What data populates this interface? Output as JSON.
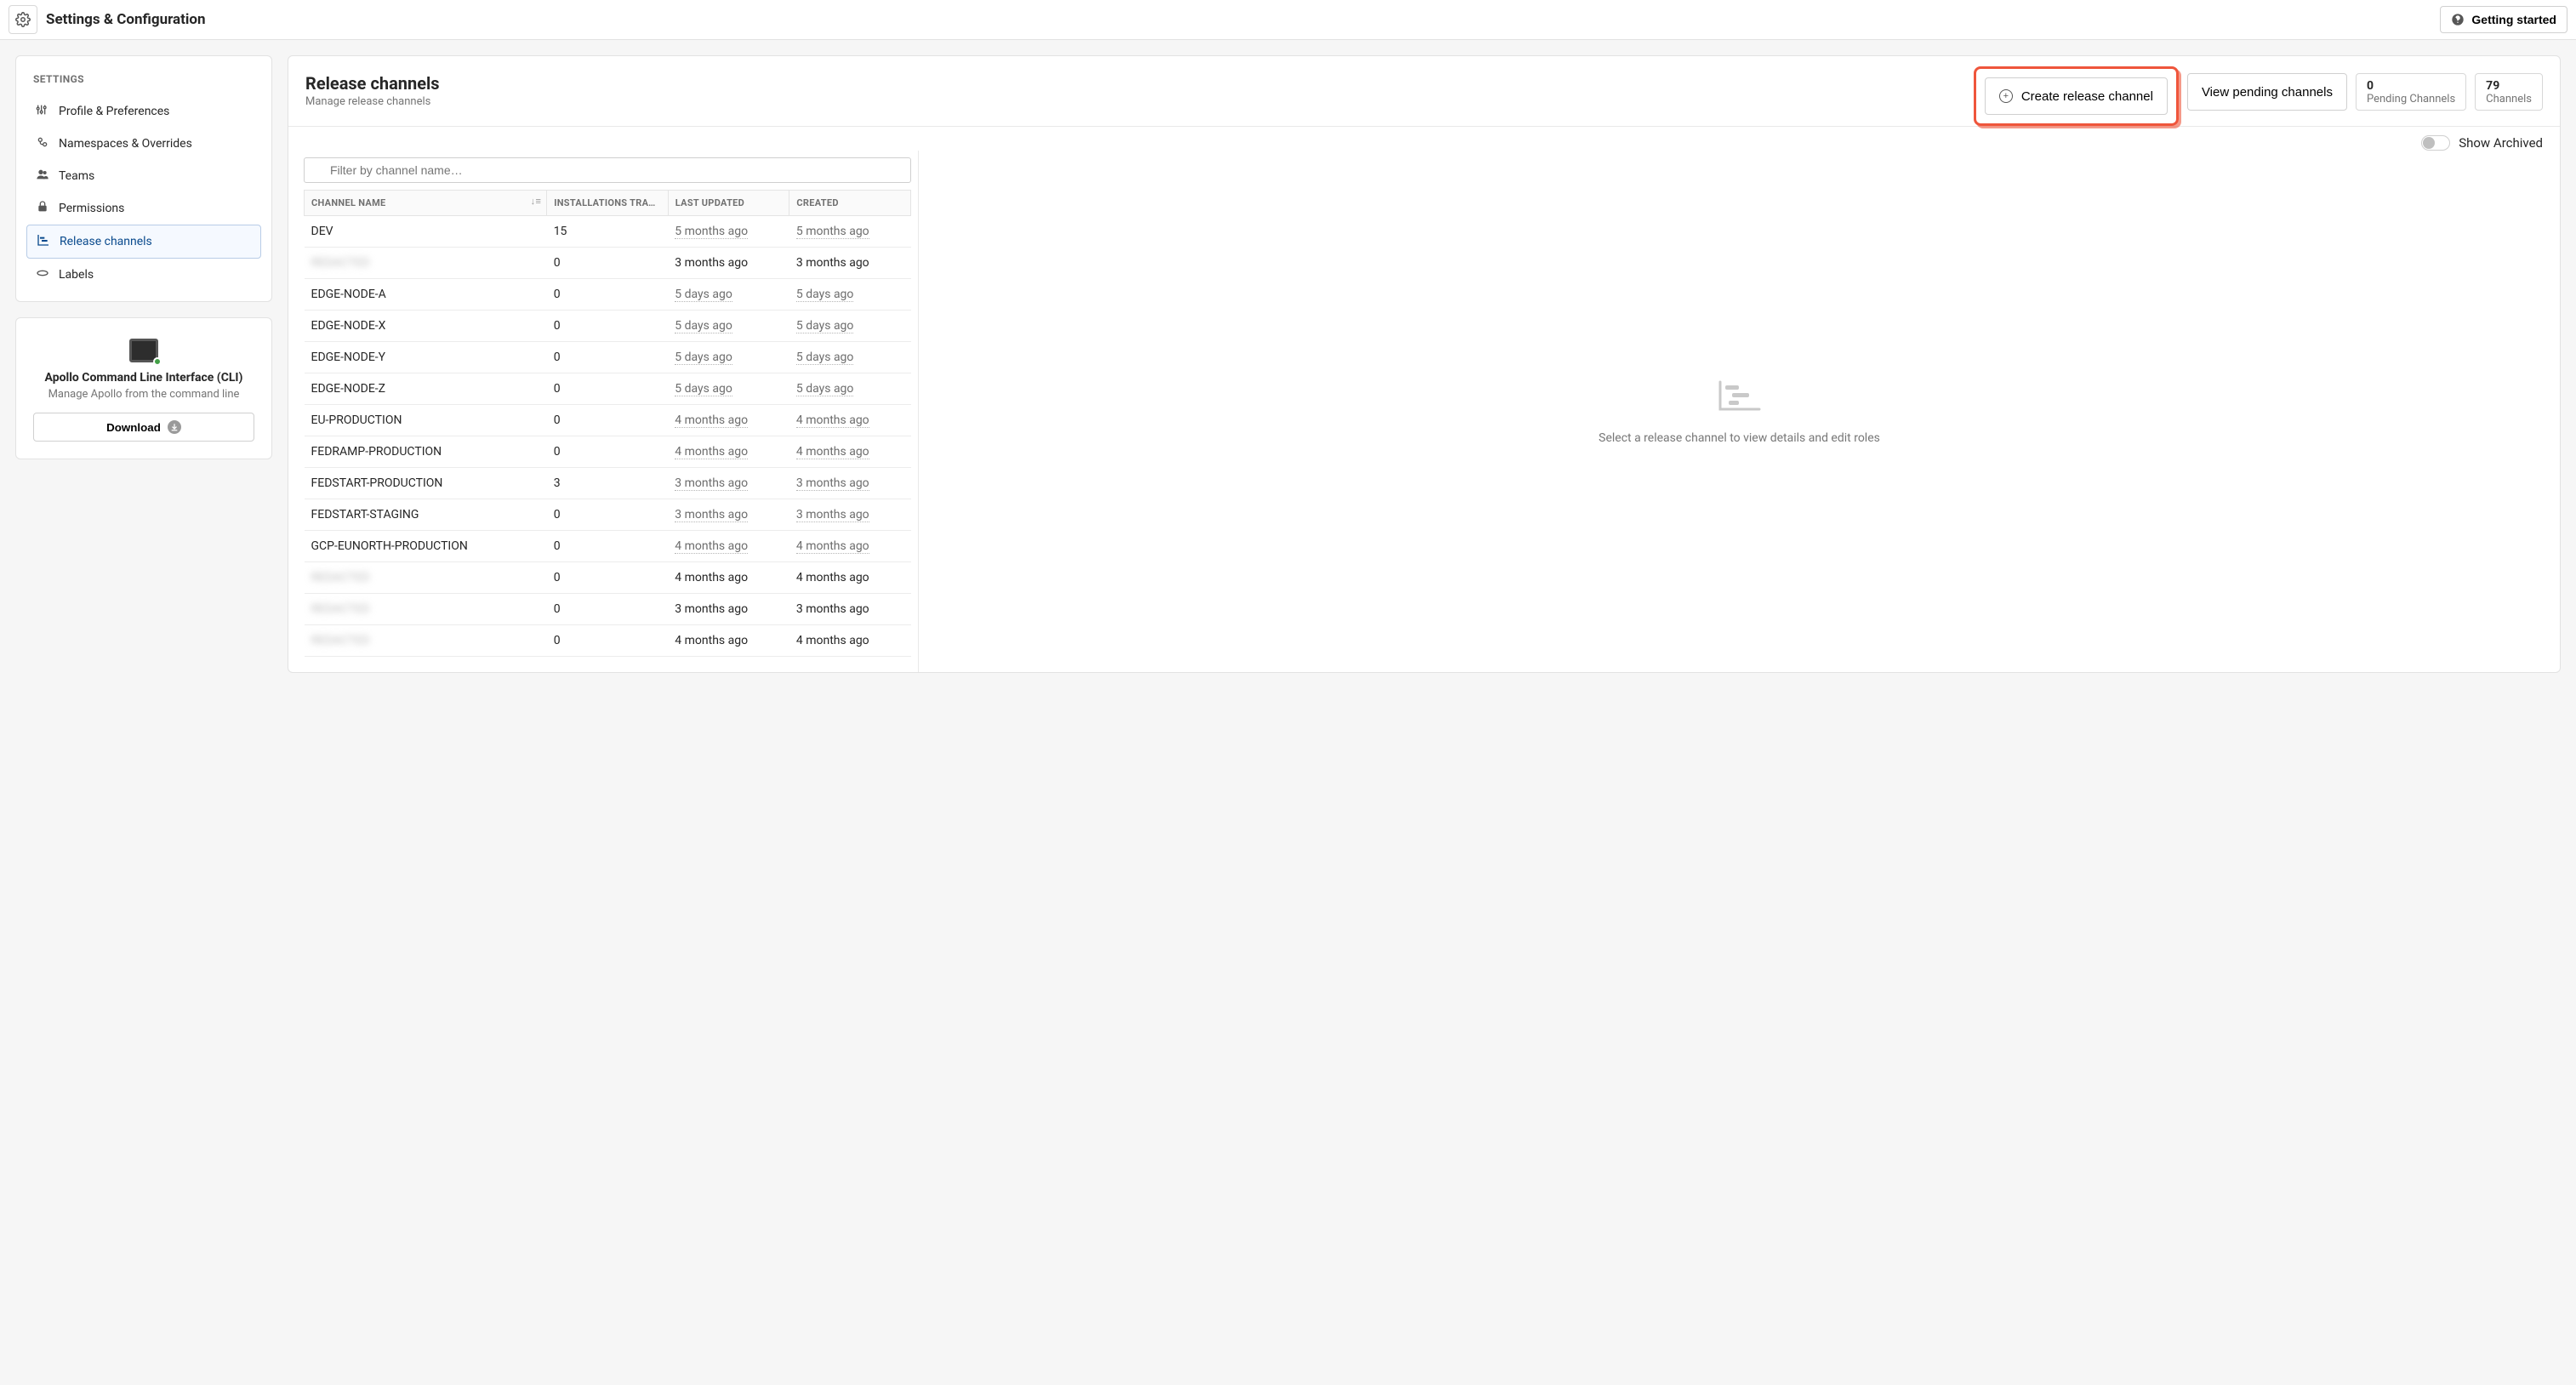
{
  "topbar": {
    "title": "Settings & Configuration",
    "getting_started": "Getting started"
  },
  "sidebar": {
    "heading": "SETTINGS",
    "items": [
      {
        "label": "Profile & Preferences",
        "selected": false
      },
      {
        "label": "Namespaces & Overrides",
        "selected": false
      },
      {
        "label": "Teams",
        "selected": false
      },
      {
        "label": "Permissions",
        "selected": false
      },
      {
        "label": "Release channels",
        "selected": true
      },
      {
        "label": "Labels",
        "selected": false
      }
    ],
    "cli": {
      "title": "Apollo Command Line Interface (CLI)",
      "subtitle": "Manage Apollo from the command line",
      "download": "Download"
    }
  },
  "main": {
    "title": "Release channels",
    "subtitle": "Manage release channels",
    "create_button": "Create release channel",
    "view_pending": "View pending channels",
    "pending_stat": {
      "count": "0",
      "label": "Pending Channels"
    },
    "channels_stat": {
      "count": "79",
      "label": "Channels"
    },
    "show_archived": "Show Archived",
    "filter": {
      "placeholder": "Filter by channel name…"
    },
    "columns": {
      "name": "CHANNEL NAME",
      "installs": "INSTALLATIONS TRAC…",
      "updated": "LAST UPDATED",
      "created": "CREATED"
    },
    "detail_empty": "Select a release channel to view details and edit roles",
    "rows": [
      {
        "name": "DEV",
        "installs": "15",
        "updated": "5 months ago",
        "created": "5 months ago",
        "blurred": false
      },
      {
        "name": "REDACTED",
        "installs": "0",
        "updated": "3 months ago",
        "created": "3 months ago",
        "blurred": true
      },
      {
        "name": "EDGE-NODE-A",
        "installs": "0",
        "updated": "5 days ago",
        "created": "5 days ago",
        "blurred": false
      },
      {
        "name": "EDGE-NODE-X",
        "installs": "0",
        "updated": "5 days ago",
        "created": "5 days ago",
        "blurred": false
      },
      {
        "name": "EDGE-NODE-Y",
        "installs": "0",
        "updated": "5 days ago",
        "created": "5 days ago",
        "blurred": false
      },
      {
        "name": "EDGE-NODE-Z",
        "installs": "0",
        "updated": "5 days ago",
        "created": "5 days ago",
        "blurred": false
      },
      {
        "name": "EU-PRODUCTION",
        "installs": "0",
        "updated": "4 months ago",
        "created": "4 months ago",
        "blurred": false
      },
      {
        "name": "FEDRAMP-PRODUCTION",
        "installs": "0",
        "updated": "4 months ago",
        "created": "4 months ago",
        "blurred": false
      },
      {
        "name": "FEDSTART-PRODUCTION",
        "installs": "3",
        "updated": "3 months ago",
        "created": "3 months ago",
        "blurred": false
      },
      {
        "name": "FEDSTART-STAGING",
        "installs": "0",
        "updated": "3 months ago",
        "created": "3 months ago",
        "blurred": false
      },
      {
        "name": "GCP-EUNORTH-PRODUCTION",
        "installs": "0",
        "updated": "4 months ago",
        "created": "4 months ago",
        "blurred": false
      },
      {
        "name": "REDACTED",
        "installs": "0",
        "updated": "4 months ago",
        "created": "4 months ago",
        "blurred": true
      },
      {
        "name": "REDACTED",
        "installs": "0",
        "updated": "3 months ago",
        "created": "3 months ago",
        "blurred": true
      },
      {
        "name": "REDACTED",
        "installs": "0",
        "updated": "4 months ago",
        "created": "4 months ago",
        "blurred": true
      }
    ]
  }
}
